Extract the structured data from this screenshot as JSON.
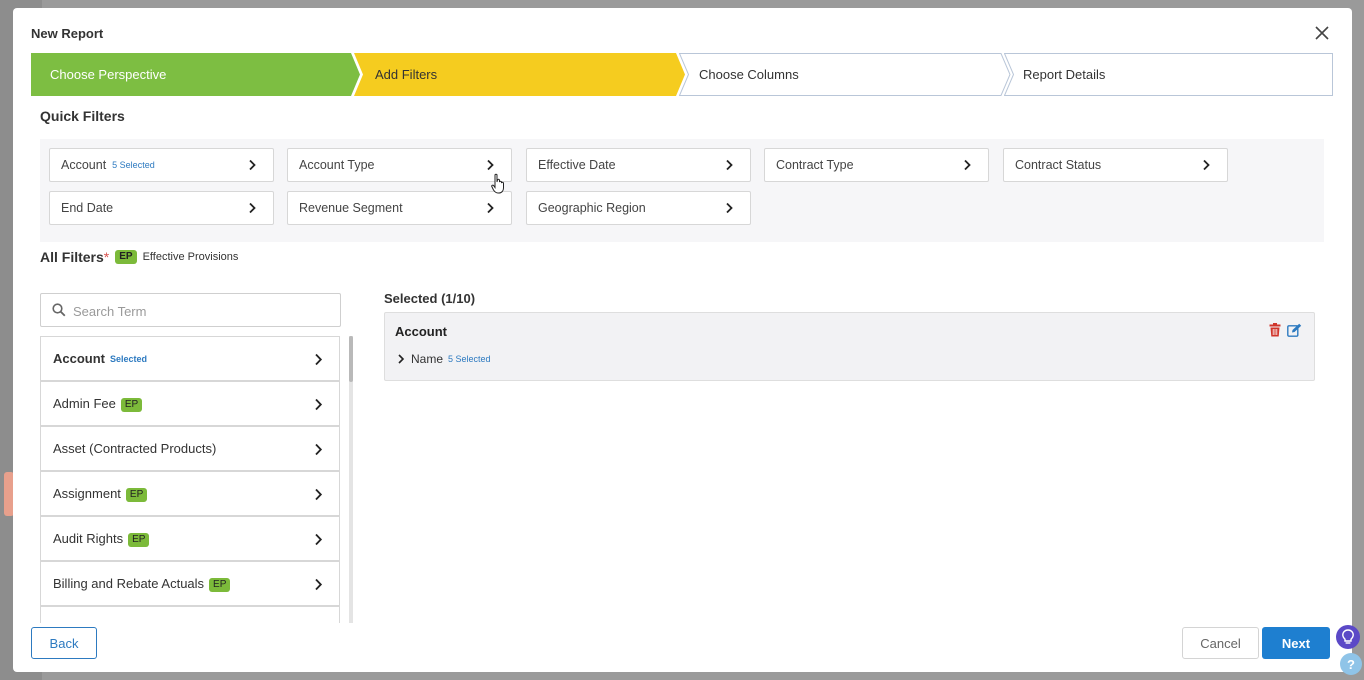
{
  "modal": {
    "title": "New Report"
  },
  "stepper": {
    "steps": [
      {
        "label": "Choose Perspective",
        "state": "complete",
        "color": "#7dbe42"
      },
      {
        "label": "Add Filters",
        "state": "current",
        "color": "#f5cc1f"
      },
      {
        "label": "Choose Columns",
        "state": "pending"
      },
      {
        "label": "Report Details",
        "state": "pending"
      }
    ]
  },
  "quick_filters": {
    "title": "Quick Filters",
    "items": [
      {
        "label": "Account",
        "selected": "5 Selected"
      },
      {
        "label": "Account Type"
      },
      {
        "label": "Effective Date"
      },
      {
        "label": "Contract Type"
      },
      {
        "label": "Contract Status"
      },
      {
        "label": "End Date"
      },
      {
        "label": "Revenue Segment"
      },
      {
        "label": "Geographic Region"
      }
    ]
  },
  "all_filters": {
    "title": "All Filters",
    "required_mark": "*",
    "badge": "EP",
    "badge_desc": "Effective Provisions",
    "search_placeholder": "Search Term",
    "items": [
      {
        "label": "Account",
        "selected": "Selected"
      },
      {
        "label": "Admin Fee",
        "badge": "EP"
      },
      {
        "label": "Asset (Contracted Products)"
      },
      {
        "label": "Assignment",
        "badge": "EP"
      },
      {
        "label": "Audit Rights",
        "badge": "EP"
      },
      {
        "label": "Billing and Rebate Actuals",
        "badge": "EP"
      }
    ]
  },
  "selected": {
    "title": "Selected (1/10)",
    "card": {
      "title": "Account",
      "field": "Name",
      "field_selected": "5 Selected"
    }
  },
  "footer": {
    "back": "Back",
    "cancel": "Cancel",
    "next": "Next"
  },
  "help": {
    "question": "?"
  }
}
